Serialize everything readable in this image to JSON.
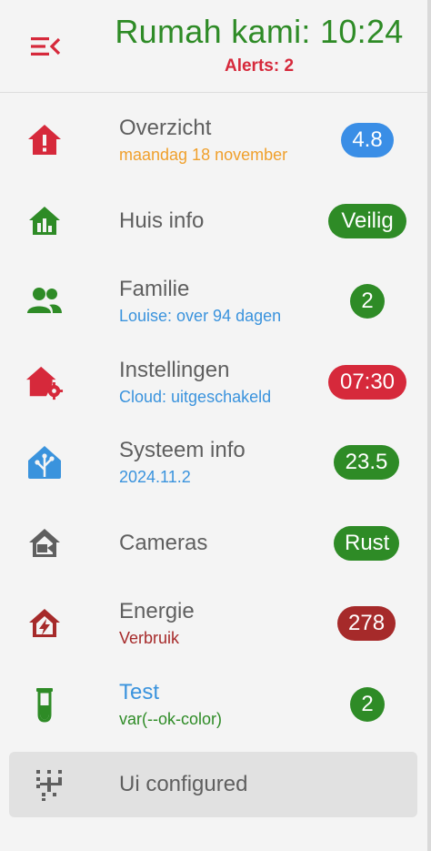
{
  "header": {
    "title": "Rumah kami: 10:24",
    "alerts": "Alerts: 2",
    "menu_icon": "menu-open-icon"
  },
  "items": [
    {
      "label": "Overzicht",
      "sub": "maandag 18 november",
      "sub_color": "#f0a02c",
      "icon": "home-alert-icon",
      "icon_color": "#d6293b",
      "badge": "4.8",
      "badge_color": "#3a8ee6"
    },
    {
      "label": "Huis info",
      "sub": "",
      "icon": "home-analytics-icon",
      "icon_color": "#2e8b26",
      "badge": "Veilig",
      "badge_color": "#2e8b26"
    },
    {
      "label": "Familie",
      "sub": "Louise: over 94 dagen",
      "sub_color": "#3a93dd",
      "icon": "account-group-icon",
      "icon_color": "#2e8b26",
      "badge": "2",
      "badge_color": "#2e8b26"
    },
    {
      "label": "Instellingen",
      "sub": "Cloud: uitgeschakeld",
      "sub_color": "#3a93dd",
      "icon": "home-cog-icon",
      "icon_color": "#d6293b",
      "badge": "07:30",
      "badge_color": "#d6293b"
    },
    {
      "label": "Systeem info",
      "sub": "2024.11.2",
      "sub_color": "#3a93dd",
      "icon": "home-assistant-icon",
      "icon_color": "#3a93dd",
      "badge": "23.5",
      "badge_color": "#2e8b26"
    },
    {
      "label": "Cameras",
      "sub": "",
      "icon": "home-camera-icon",
      "icon_color": "#5f5f5f",
      "badge": "Rust",
      "badge_color": "#2e8b26"
    },
    {
      "label": "Energie",
      "sub": "Verbruik",
      "sub_color": "#a62a2a",
      "icon": "home-lightning-icon",
      "icon_color": "#a62a2a",
      "badge": "278",
      "badge_color": "#a62a2a"
    },
    {
      "label": "Test",
      "label_color": "#3a93dd",
      "sub": "var(--ok-color)",
      "sub_color": "#2e8b26",
      "icon": "test-tube-icon",
      "icon_color": "#2e8b26",
      "badge": "2",
      "badge_color": "#2e8b26"
    }
  ],
  "selected_item": {
    "label": "Ui configured",
    "icon": "hashtag-grid-icon",
    "icon_color": "#5f5f5f"
  }
}
